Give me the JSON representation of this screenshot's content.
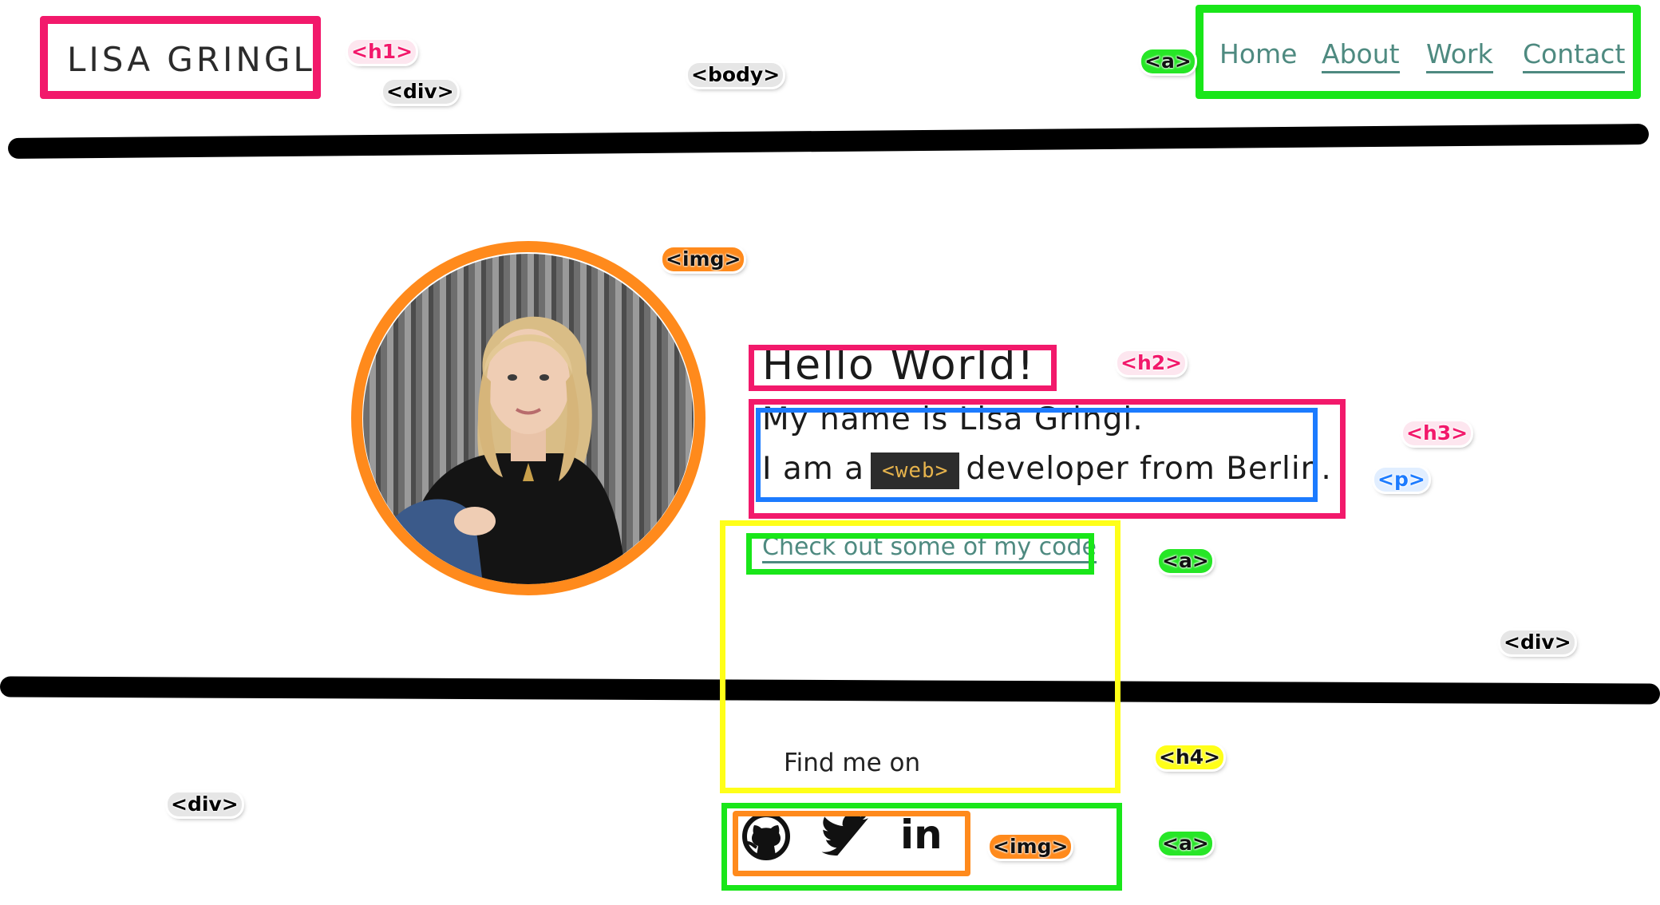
{
  "header": {
    "logo": "LISA GRINGL",
    "nav": [
      {
        "label": "Home"
      },
      {
        "label": "About"
      },
      {
        "label": "Work"
      },
      {
        "label": "Contact"
      }
    ]
  },
  "hero": {
    "greeting": "Hello World!",
    "intro_line1": "My name is Lisa Gringl.",
    "intro_prefix": "I am a",
    "code_chip": "<web>",
    "intro_suffix": "developer from Berlin.",
    "code_link": "Check out some of my code"
  },
  "footer": {
    "find_me": "Find me on",
    "socials": [
      "github-icon",
      "twitter-icon",
      "linkedin-icon"
    ],
    "linkedin_text": "in"
  },
  "annotations": {
    "h1": "<h1>",
    "div_header": "<div>",
    "body": "<body>",
    "a_nav": "<a>",
    "img_avatar": "<img>",
    "h2": "<h2>",
    "h3": "<h3>",
    "p": "<p>",
    "a_code": "<a>",
    "div_main": "<div>",
    "h4": "<h4>",
    "div_footer": "<div>",
    "img_social": "<img>",
    "a_social": "<a>"
  },
  "colors": {
    "pink": "#f2196b",
    "green": "#19e619",
    "orange": "#ff8a1c",
    "yellow": "#ffff18",
    "blue": "#1c7bff",
    "link": "#4e8a80"
  }
}
